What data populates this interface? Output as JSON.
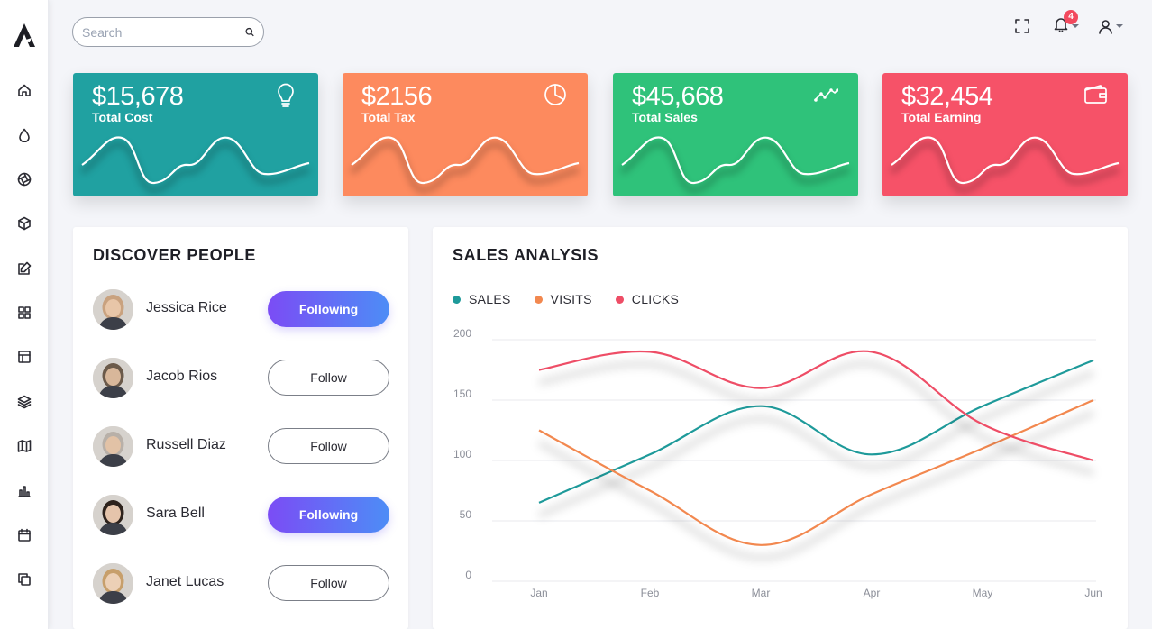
{
  "sidebar": {
    "logo": "A",
    "items": [
      {
        "icon": "home-icon"
      },
      {
        "icon": "drop-icon"
      },
      {
        "icon": "aperture-icon"
      },
      {
        "icon": "box-icon"
      },
      {
        "icon": "edit-icon"
      },
      {
        "icon": "grid-icon"
      },
      {
        "icon": "layout-icon"
      },
      {
        "icon": "layers-icon"
      },
      {
        "icon": "map-icon"
      },
      {
        "icon": "bar-chart-icon"
      },
      {
        "icon": "calendar-icon"
      },
      {
        "icon": "copy-icon"
      }
    ]
  },
  "topbar": {
    "search_placeholder": "Search",
    "notification_count": "4"
  },
  "stats": [
    {
      "value": "$15,678",
      "label": "Total Cost",
      "color": "#20a1a1",
      "icon": "bulb-icon"
    },
    {
      "value": "$2156",
      "label": "Total Tax",
      "color": "#fd8a5e",
      "icon": "pie-chart-icon"
    },
    {
      "value": "$45,668",
      "label": "Total Sales",
      "color": "#2fc27a",
      "icon": "trending-up-icon"
    },
    {
      "value": "$32,454",
      "label": "Total Earning",
      "color": "#f65268",
      "icon": "wallet-icon"
    }
  ],
  "discover": {
    "title": "DISCOVER PEOPLE",
    "people": [
      {
        "name": "Jessica Rice",
        "button": "Following",
        "following": true
      },
      {
        "name": "Jacob Rios",
        "button": "Follow",
        "following": false
      },
      {
        "name": "Russell Diaz",
        "button": "Follow",
        "following": false
      },
      {
        "name": "Sara Bell",
        "button": "Following",
        "following": true
      },
      {
        "name": "Janet Lucas",
        "button": "Follow",
        "following": false
      }
    ]
  },
  "sales": {
    "title": "SALES ANALYSIS",
    "legend": [
      {
        "label": "SALES",
        "color": "#1e9a9a"
      },
      {
        "label": "VISITS",
        "color": "#f2884f"
      },
      {
        "label": "CLICKS",
        "color": "#ee4d66"
      }
    ]
  },
  "chart_data": {
    "type": "line",
    "x": [
      "Jan",
      "Feb",
      "Mar",
      "Apr",
      "May",
      "Jun"
    ],
    "series": [
      {
        "name": "SALES",
        "color": "#1e9a9a",
        "values": [
          65,
          105,
          145,
          105,
          145,
          183
        ]
      },
      {
        "name": "VISITS",
        "color": "#f2884f",
        "values": [
          125,
          75,
          30,
          72,
          110,
          150
        ]
      },
      {
        "name": "CLICKS",
        "color": "#ee4d66",
        "values": [
          175,
          190,
          160,
          190,
          130,
          100
        ]
      }
    ],
    "yticks": [
      0,
      50,
      100,
      150,
      200
    ],
    "ylim": [
      0,
      200
    ],
    "grid": true,
    "legend": "top-left"
  }
}
